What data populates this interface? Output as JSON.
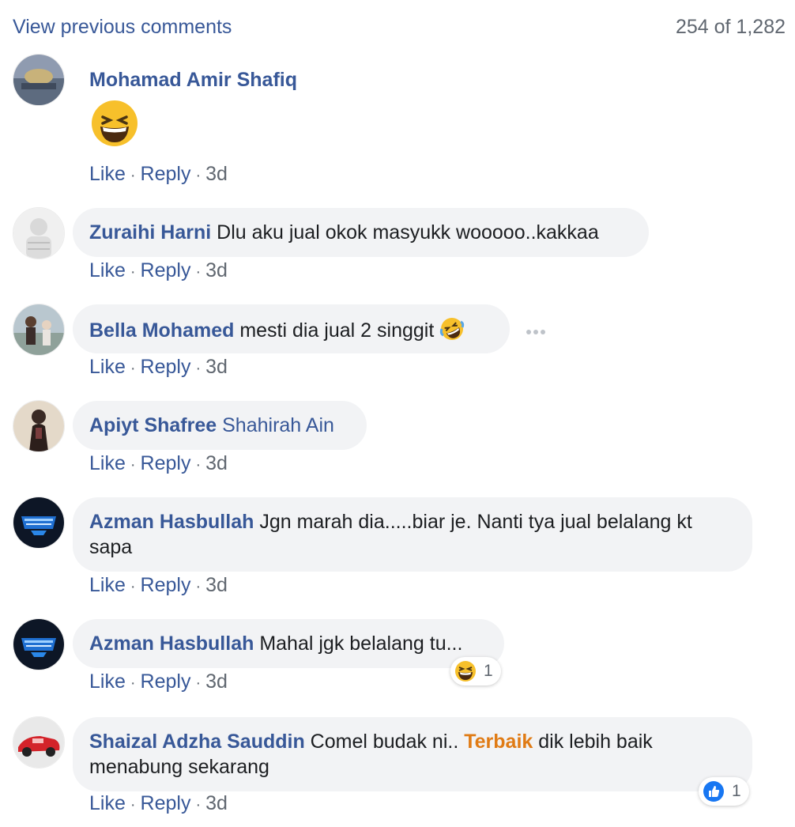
{
  "header": {
    "view_previous": "View previous comments",
    "count": "254 of 1,282"
  },
  "action_labels": {
    "like": "Like",
    "reply": "Reply",
    "separator": "·"
  },
  "colors": {
    "link": "#385898",
    "meta": "#606770",
    "bubble": "#f2f3f5",
    "highlight": "#e07b15"
  },
  "comments": [
    {
      "author": "Mohamad Amir Shafiq",
      "text": "",
      "emoji": "grinning-squinting-face",
      "time": "3d"
    },
    {
      "author": "Zuraihi Harni",
      "text": "Dlu aku jual okok masyukk wooooo..kakkaa",
      "time": "3d"
    },
    {
      "author": "Bella Mohamed",
      "text": "mesti dia jual 2 singgit",
      "emoji": "rolling-on-floor-laughing",
      "time": "3d"
    },
    {
      "author": "Apiyt Shafree",
      "tag": "Shahirah Ain",
      "text": "",
      "time": "3d"
    },
    {
      "author": "Azman Hasbullah",
      "text": "Jgn marah dia.....biar je. Nanti tya jual belalang kt sapa",
      "time": "3d"
    },
    {
      "author": "Azman Hasbullah",
      "text": "Mahal jgk belalang tu...",
      "time": "3d",
      "reaction": {
        "type": "haha-icon",
        "count": "1"
      }
    },
    {
      "author": "Shaizal Adzha Sauddin",
      "text_before": "Comel budak ni..",
      "highlight": "Terbaik",
      "text_after": "dik lebih baik menabung sekarang",
      "time": "3d",
      "reaction": {
        "type": "like-icon",
        "count": "1"
      }
    }
  ]
}
